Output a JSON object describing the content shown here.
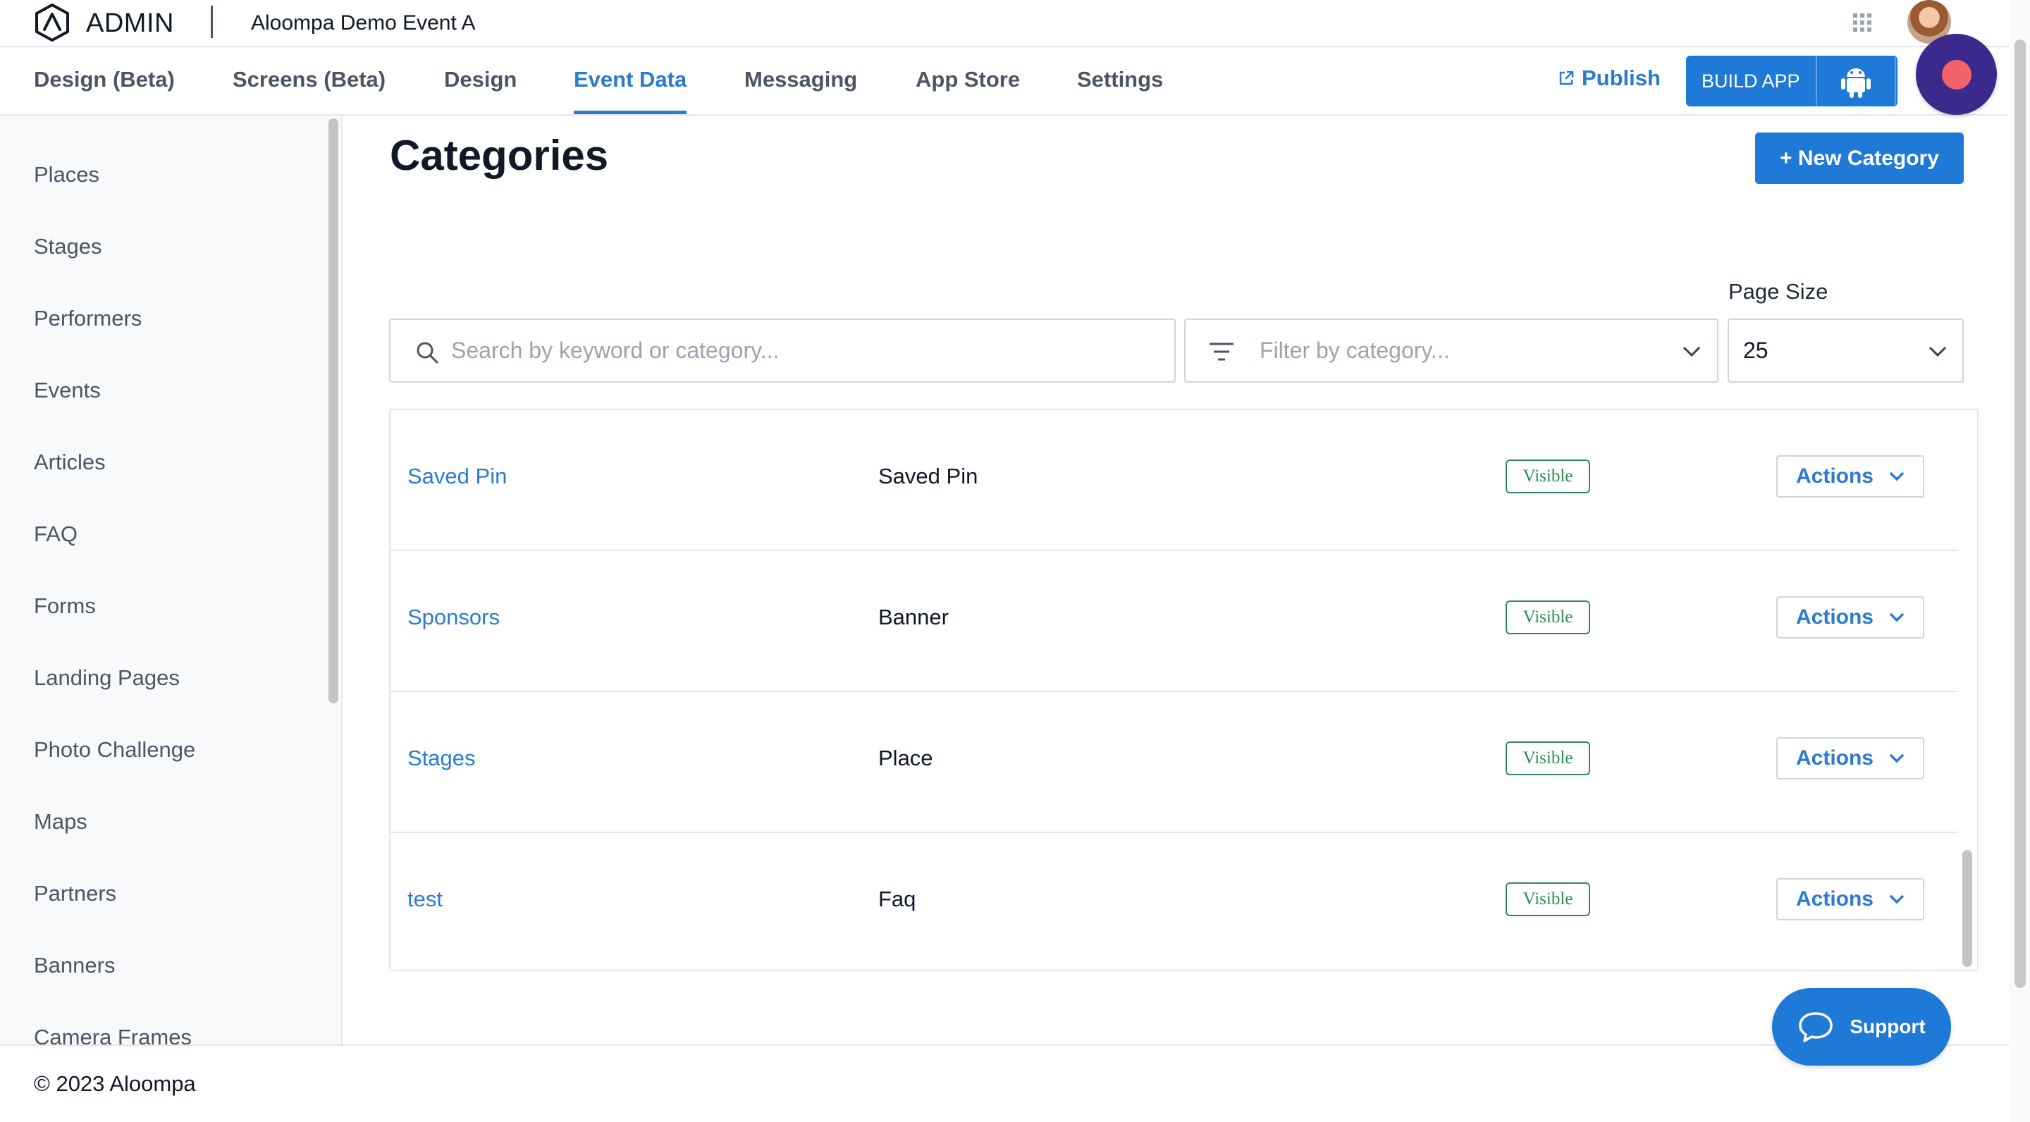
{
  "header": {
    "brand": "ADMIN",
    "event_name": "Aloompa Demo Event A",
    "icons": [
      "logo-icon",
      "apps-grid-icon",
      "avatar"
    ]
  },
  "nav": {
    "tabs": [
      {
        "label": "Design (Beta)",
        "active": false
      },
      {
        "label": "Screens (Beta)",
        "active": false
      },
      {
        "label": "Design",
        "active": false
      },
      {
        "label": "Event Data",
        "active": true
      },
      {
        "label": "Messaging",
        "active": false
      },
      {
        "label": "App Store",
        "active": false
      },
      {
        "label": "Settings",
        "active": false
      }
    ],
    "publish_label": "Publish",
    "build_label": "BUILD APP"
  },
  "sidebar": {
    "items": [
      {
        "label": "Places"
      },
      {
        "label": "Stages"
      },
      {
        "label": "Performers"
      },
      {
        "label": "Events"
      },
      {
        "label": "Articles"
      },
      {
        "label": "FAQ"
      },
      {
        "label": "Forms"
      },
      {
        "label": "Landing Pages"
      },
      {
        "label": "Photo Challenge"
      },
      {
        "label": "Maps"
      },
      {
        "label": "Partners"
      },
      {
        "label": "Banners"
      },
      {
        "label": "Camera Frames"
      }
    ]
  },
  "main": {
    "title": "Categories",
    "new_button": "+ New Category",
    "search_placeholder": "Search by keyword or category...",
    "filter_placeholder": "Filter by category...",
    "page_size_label": "Page Size",
    "page_size_value": "25",
    "rows": [
      {
        "name": "Saved Pin",
        "type": "Saved Pin",
        "status": "Visible",
        "actions": "Actions"
      },
      {
        "name": "Sponsors",
        "type": "Banner",
        "status": "Visible",
        "actions": "Actions"
      },
      {
        "name": "Stages",
        "type": "Place",
        "status": "Visible",
        "actions": "Actions"
      },
      {
        "name": "test",
        "type": "Faq",
        "status": "Visible",
        "actions": "Actions"
      }
    ]
  },
  "footer": {
    "text": "© 2023 Aloompa"
  },
  "support": {
    "label": "Support"
  },
  "colors": {
    "primary": "#1e7ad6",
    "link": "#2b7bd1",
    "visible_badge": "#2e8b57",
    "record_bg": "#3b2a8c",
    "record_dot": "#f2636b"
  }
}
